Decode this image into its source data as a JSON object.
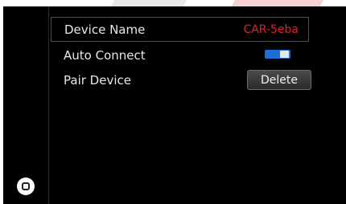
{
  "settings": {
    "rows": [
      {
        "label": "Device Name",
        "value": "CAR-5eba"
      },
      {
        "label": "Auto Connect",
        "toggle_on": true
      },
      {
        "label": "Pair Device",
        "button_label": "Delete"
      }
    ]
  },
  "colors": {
    "selection_border": "#b5232a",
    "value_text": "#d7262d",
    "toggle_on": "#1d6fd8",
    "background_stripe": "#f2c6c6"
  }
}
